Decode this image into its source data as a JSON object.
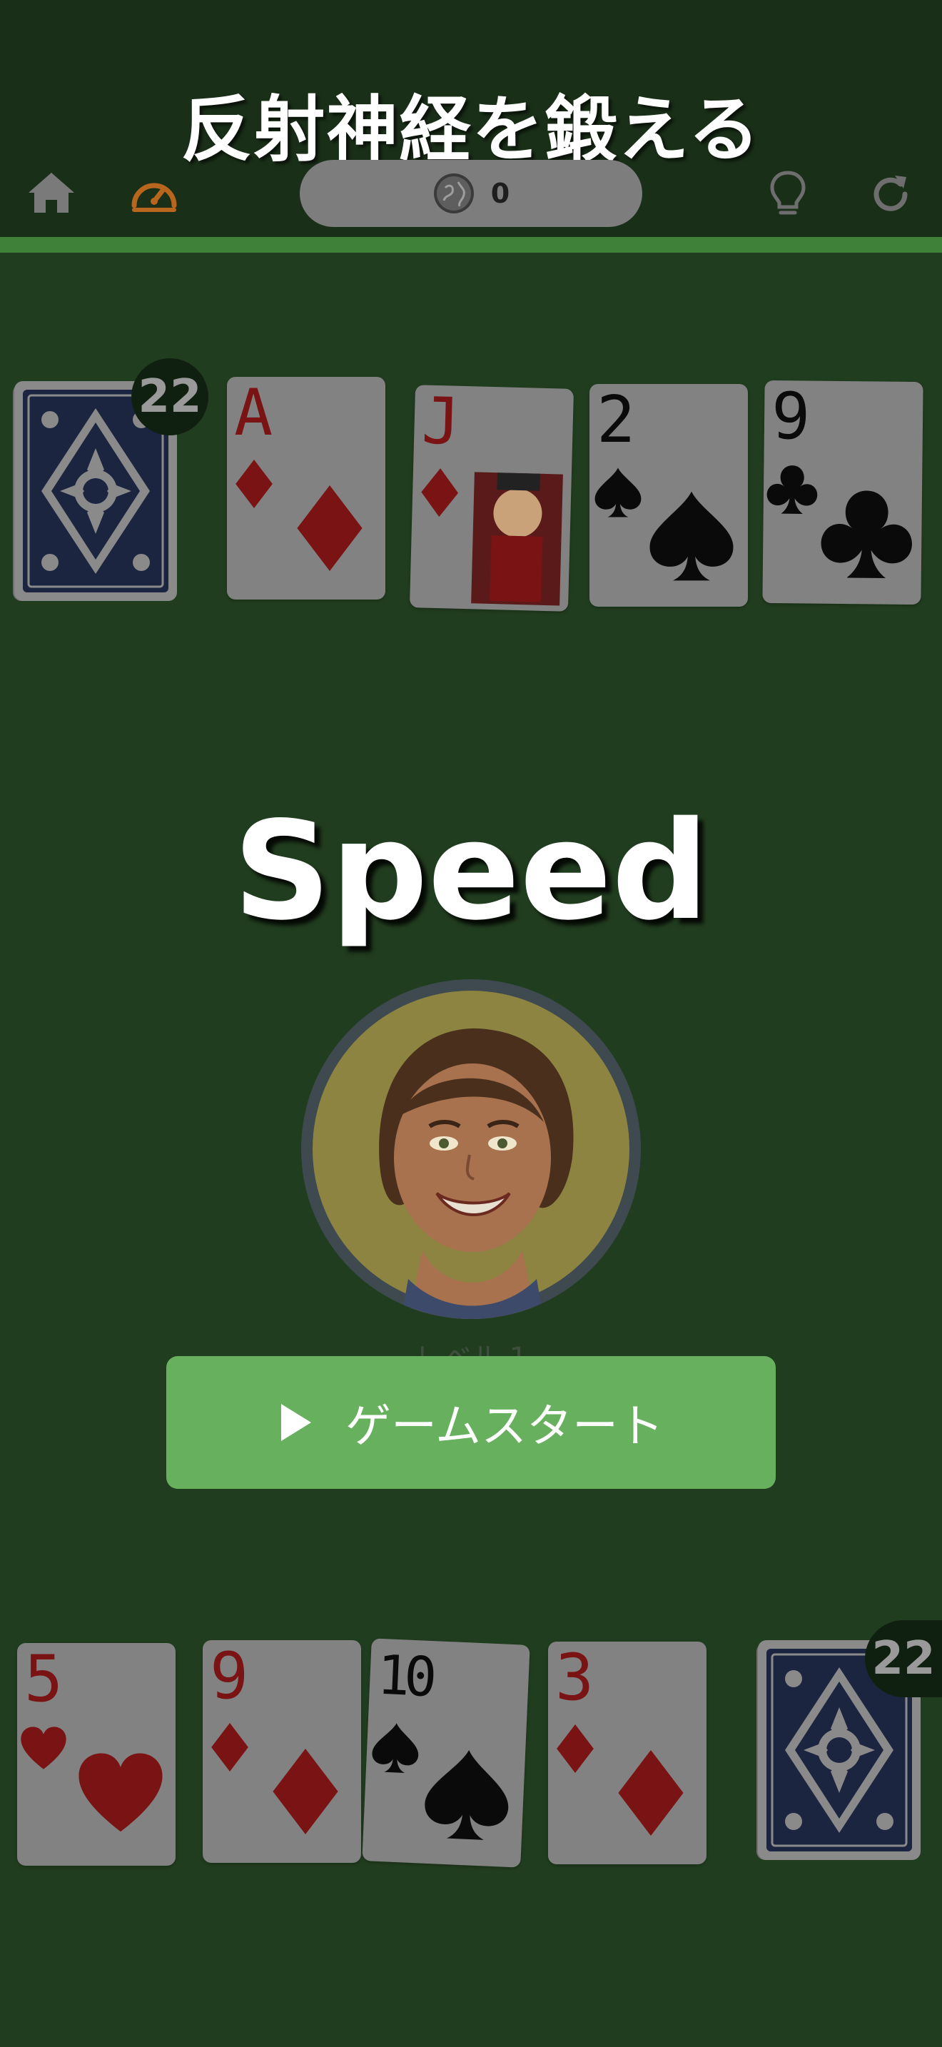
{
  "header": {
    "title": "反射神経を鍛える",
    "coin_count": "0",
    "icons": [
      "home-icon",
      "speedometer-icon",
      "globe-coin-icon",
      "lightbulb-icon",
      "refresh-icon"
    ],
    "accent_color": "#b8651d"
  },
  "game": {
    "title": "Speed",
    "level_label": "レベル 1",
    "start_button_label": "ゲームスタート"
  },
  "opponent": {
    "deck_count": "22",
    "cards": [
      {
        "rank": "A",
        "suit": "diamond",
        "color": "red"
      },
      {
        "rank": "J",
        "suit": "diamond",
        "color": "red"
      },
      {
        "rank": "2",
        "suit": "spade",
        "color": "black"
      },
      {
        "rank": "9",
        "suit": "club",
        "color": "black"
      }
    ]
  },
  "player": {
    "deck_count": "22",
    "cards": [
      {
        "rank": "5",
        "suit": "heart",
        "color": "red"
      },
      {
        "rank": "9",
        "suit": "diamond",
        "color": "red"
      },
      {
        "rank": "10",
        "suit": "spade",
        "color": "black"
      },
      {
        "rank": "3",
        "suit": "diamond",
        "color": "red"
      }
    ]
  },
  "colors": {
    "felt": "#213d1f",
    "header": "#1a2f18",
    "start_button": "#67b05e",
    "progress": "#3f8139"
  }
}
